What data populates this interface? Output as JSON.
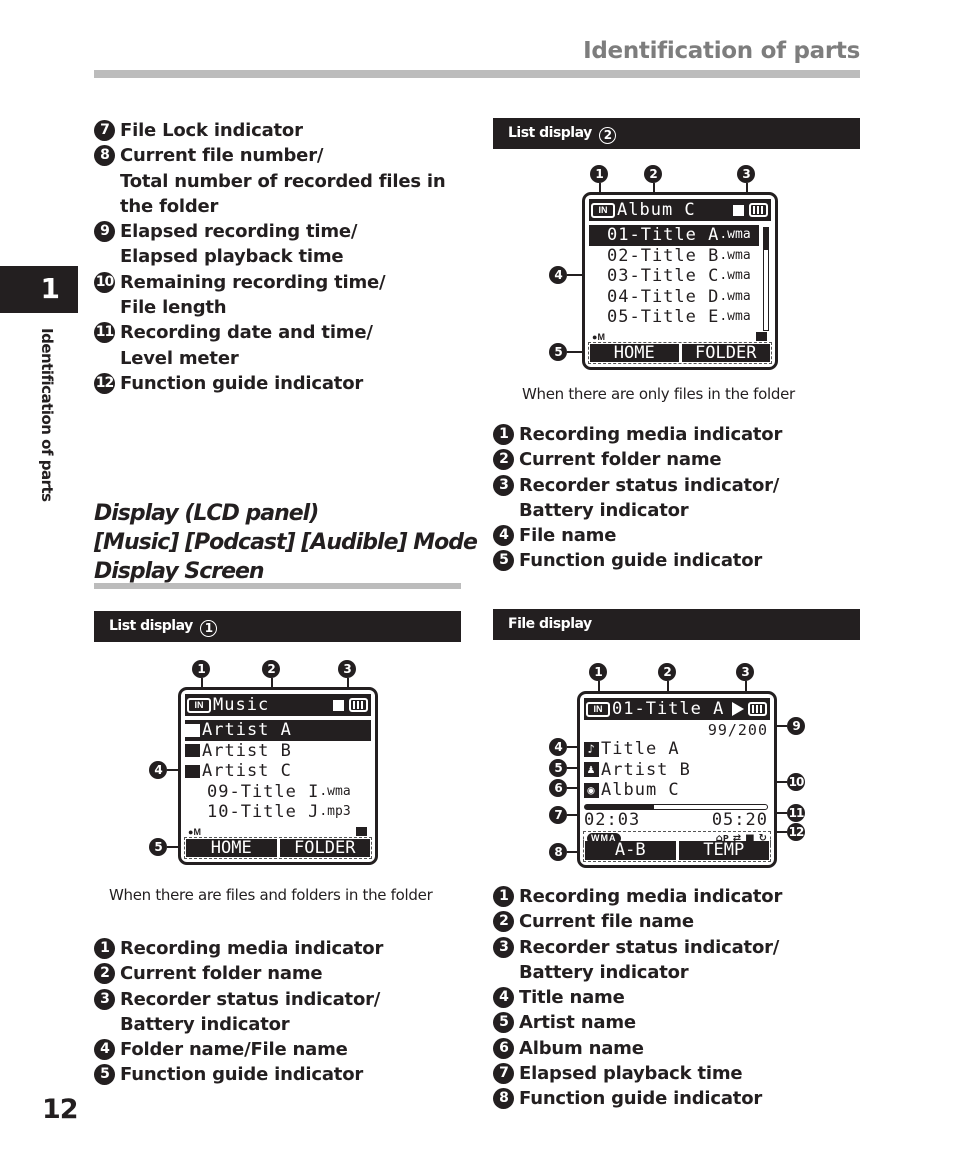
{
  "header": {
    "title": "Identification of parts"
  },
  "side_tab": {
    "chapter": "1",
    "label": "Identification of parts"
  },
  "page_number": "12",
  "continued_legend": [
    {
      "num": "7",
      "text": "File Lock indicator"
    },
    {
      "num": "8",
      "text": "Current file number/\nTotal number of recorded files in\nthe folder"
    },
    {
      "num": "9",
      "text": "Elapsed recording time/\nElapsed playback time"
    },
    {
      "num": "10",
      "text": "Remaining recording time/\nFile length"
    },
    {
      "num": "11",
      "text": "Recording date and time/\nLevel meter"
    },
    {
      "num": "12",
      "text": "Function guide indicator"
    }
  ],
  "section": {
    "heading_lines": [
      "Display (LCD panel)",
      "[Music] [Podcast] [Audible] Mode",
      "Display Screen"
    ]
  },
  "list_display_1": {
    "heading": "List display",
    "heading_num": "1",
    "screen": {
      "media": "IN",
      "folder_name": "Music",
      "rows": [
        {
          "type": "folder",
          "name": "Artist A",
          "selected": true
        },
        {
          "type": "folder",
          "name": "Artist B",
          "selected": false
        },
        {
          "type": "folder",
          "name": "Artist C",
          "selected": false
        },
        {
          "type": "file",
          "name": "09-Title I",
          "ext": ".wma",
          "selected": false
        },
        {
          "type": "file",
          "name": "10-Title J",
          "ext": ".mp3",
          "selected": false
        }
      ],
      "mic_label": "M",
      "guide_buttons": [
        "HOME",
        "FOLDER"
      ]
    },
    "callouts": [
      "1",
      "2",
      "3",
      "4",
      "5"
    ],
    "caption": "When there are files and folders in the folder",
    "legend": [
      {
        "num": "1",
        "text": "Recording media indicator"
      },
      {
        "num": "2",
        "text": "Current folder name"
      },
      {
        "num": "3",
        "text": "Recorder status indicator/\nBattery indicator"
      },
      {
        "num": "4",
        "text": "Folder name/File name"
      },
      {
        "num": "5",
        "text": "Function guide indicator"
      }
    ]
  },
  "list_display_2": {
    "heading": "List display",
    "heading_num": "2",
    "screen": {
      "media": "IN",
      "folder_name": "Album C",
      "rows": [
        {
          "name": "01-Title A",
          "ext": ".wma",
          "selected": true
        },
        {
          "name": "02-Title B",
          "ext": ".wma",
          "selected": false
        },
        {
          "name": "03-Title C",
          "ext": ".wma",
          "selected": false
        },
        {
          "name": "04-Title D",
          "ext": ".wma",
          "selected": false
        },
        {
          "name": "05-Title E",
          "ext": ".wma",
          "selected": false
        }
      ],
      "mic_label": "M",
      "guide_buttons": [
        "HOME",
        "FOLDER"
      ]
    },
    "callouts": [
      "1",
      "2",
      "3",
      "4",
      "5"
    ],
    "caption": "When there are only files in the folder",
    "legend": [
      {
        "num": "1",
        "text": "Recording media indicator"
      },
      {
        "num": "2",
        "text": "Current folder name"
      },
      {
        "num": "3",
        "text": "Recorder status indicator/\nBattery indicator"
      },
      {
        "num": "4",
        "text": "File name"
      },
      {
        "num": "5",
        "text": "Function guide indicator"
      }
    ]
  },
  "file_display": {
    "heading": "File display",
    "screen": {
      "media": "IN",
      "file_name": "01-Title A",
      "file_counter": "99/200",
      "title": "Title A",
      "artist": "Artist B",
      "album": "Album C",
      "progress_fraction": 0.38,
      "elapsed": "02:03",
      "length": "05:20",
      "format_badge": "WMA",
      "indicator_icons": [
        "ap-icon",
        "shuffle-icon",
        "lock-icon",
        "repeat-icon"
      ],
      "ap_label": "P",
      "guide_buttons": [
        "A-B",
        "TEMP"
      ]
    },
    "callouts": [
      "1",
      "2",
      "3",
      "4",
      "5",
      "6",
      "7",
      "8",
      "9",
      "10",
      "11",
      "12"
    ],
    "legend": [
      {
        "num": "1",
        "text": "Recording media indicator"
      },
      {
        "num": "2",
        "text": "Current file name"
      },
      {
        "num": "3",
        "text": "Recorder status indicator/\nBattery indicator"
      },
      {
        "num": "4",
        "text": "Title name"
      },
      {
        "num": "5",
        "text": "Artist name"
      },
      {
        "num": "6",
        "text": "Album name"
      },
      {
        "num": "7",
        "text": "Elapsed playback time"
      },
      {
        "num": "8",
        "text": "Function guide indicator"
      }
    ]
  }
}
